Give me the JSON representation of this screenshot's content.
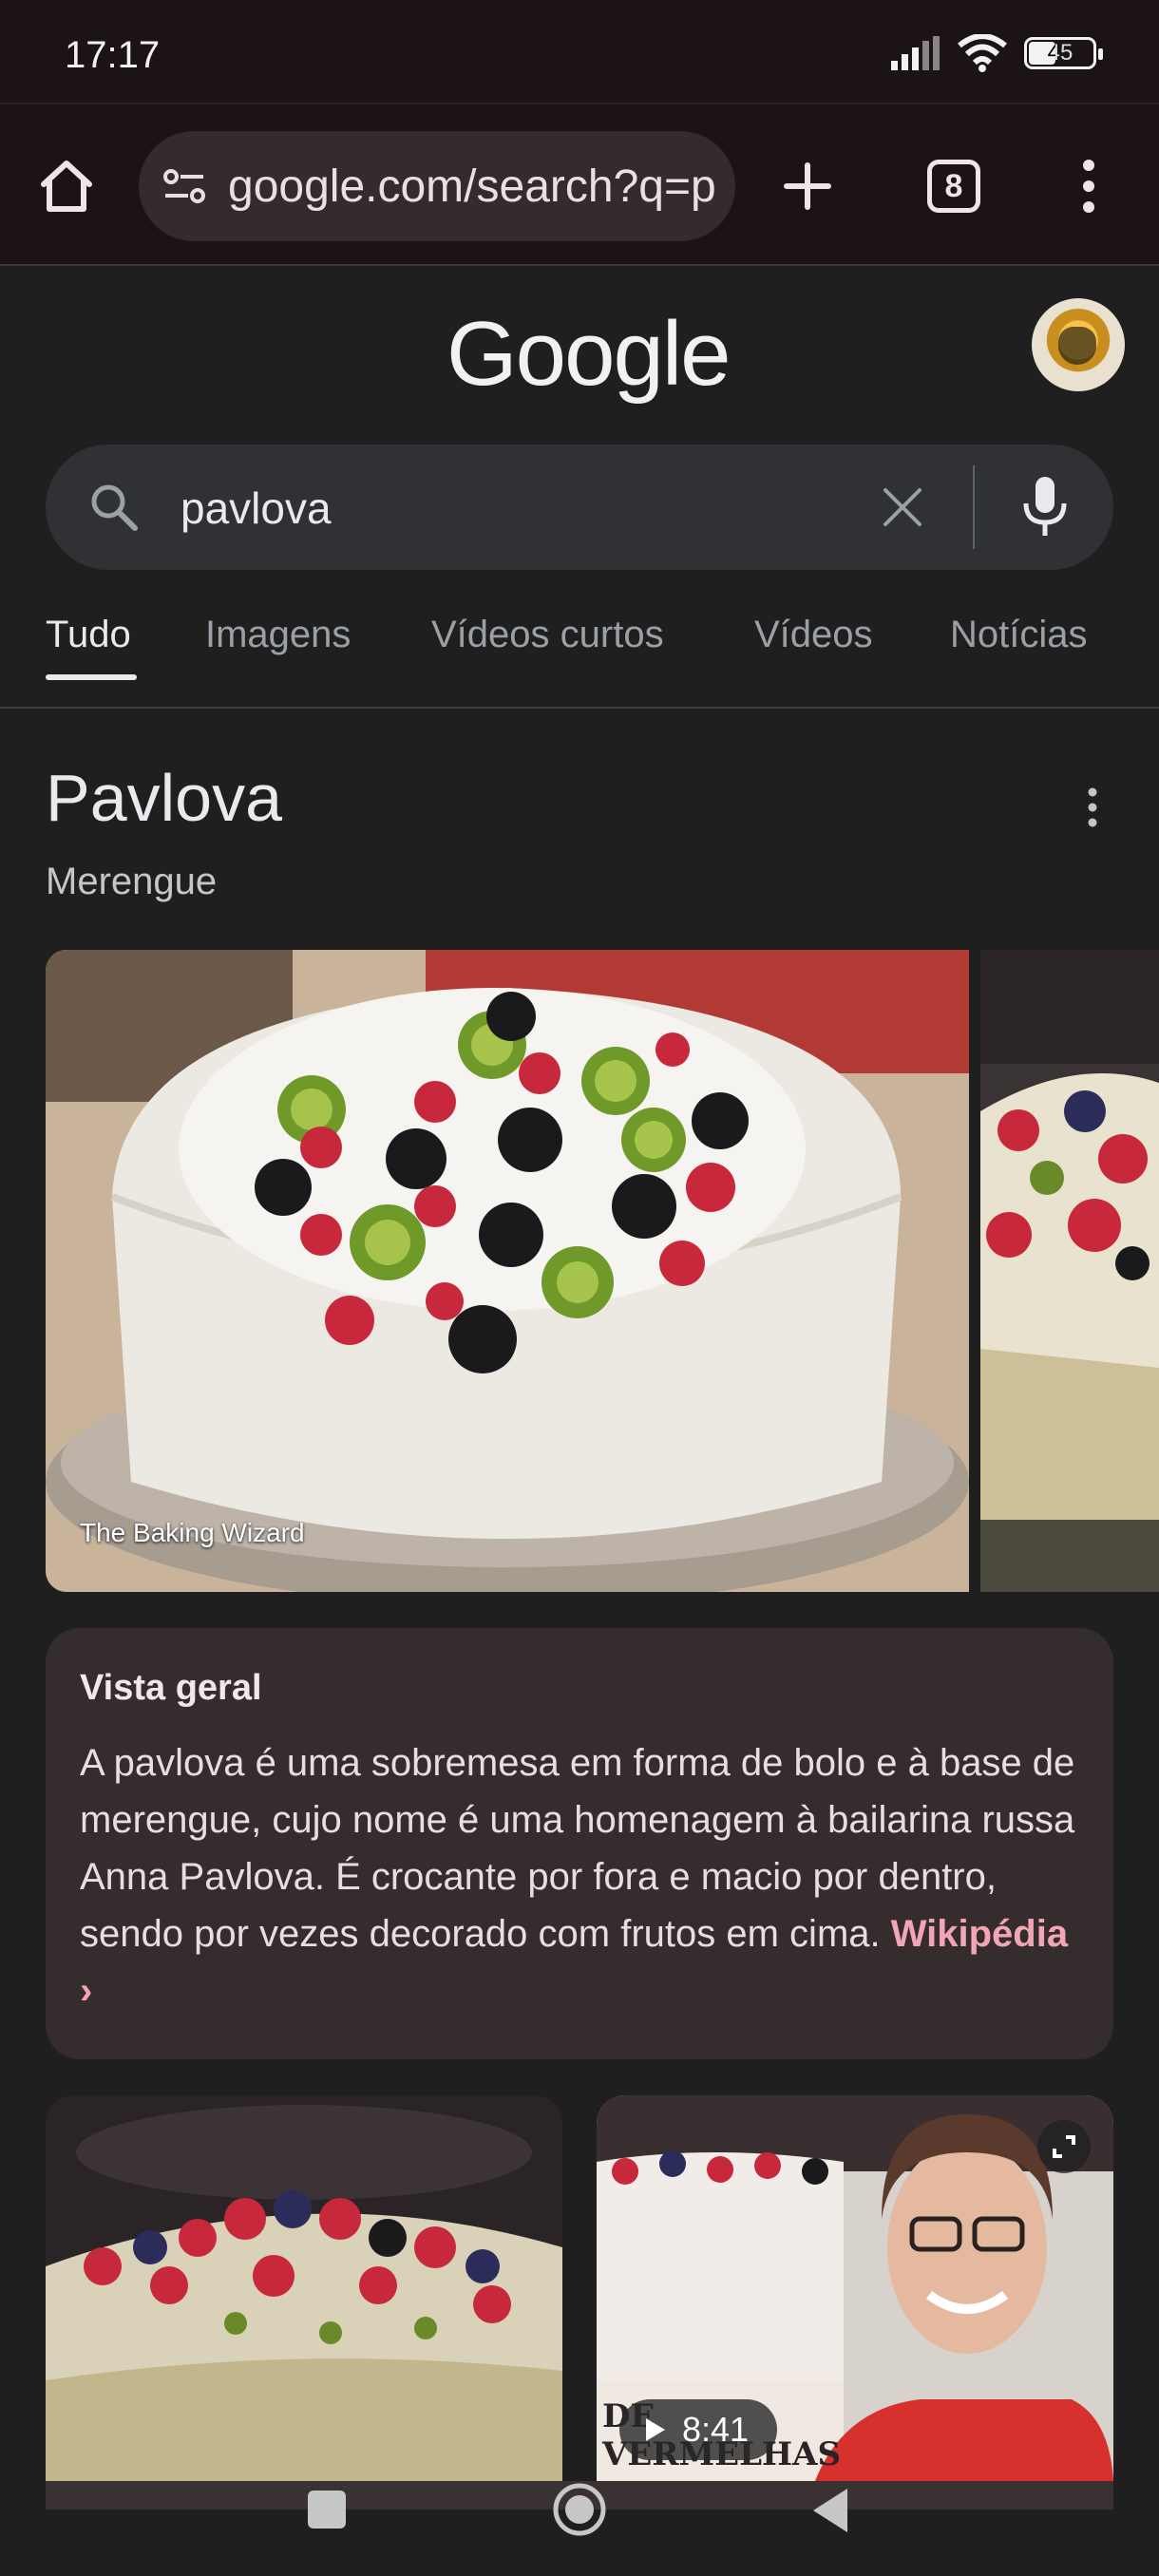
{
  "status_bar": {
    "time": "17:17",
    "battery": "45",
    "icons": [
      "signal-icon",
      "wifi-icon",
      "battery-icon"
    ]
  },
  "browser": {
    "url": "google.com/search?q=p",
    "tab_count": "8",
    "icons": [
      "home-icon",
      "site-settings-icon",
      "new-tab-icon",
      "tab-switcher-icon",
      "menu-icon"
    ]
  },
  "google": {
    "logo": "Google"
  },
  "search": {
    "query": "pavlova"
  },
  "tabs": [
    {
      "label": "Tudo",
      "active": true
    },
    {
      "label": "Imagens",
      "active": false
    },
    {
      "label": "Vídeos curtos",
      "active": false
    },
    {
      "label": "Vídeos",
      "active": false
    },
    {
      "label": "Notícias",
      "active": false
    }
  ],
  "knowledge_panel": {
    "title": "Pavlova",
    "subtitle": "Merengue",
    "image_credit": "The Baking Wizard"
  },
  "overview": {
    "heading": "Vista geral",
    "text": "A pavlova é uma sobremesa em forma de bolo e à base de merengue, cujo nome é uma homenagem à bailarina russa Anna Pavlova. É crocante por fora e macio por dentro, sendo por vezes decorado com frutos em cima. ",
    "link": "Wikipédia ›"
  },
  "video": {
    "duration": "8:41",
    "overlay_text": "DE VERMELHAS"
  },
  "colors": {
    "background": "#1f1f1f",
    "toolbar": "#1b1314",
    "omnibox": "#362b2c",
    "search_box": "#303134",
    "overview_card": "#352d2d",
    "link": "#f2a5b4"
  }
}
